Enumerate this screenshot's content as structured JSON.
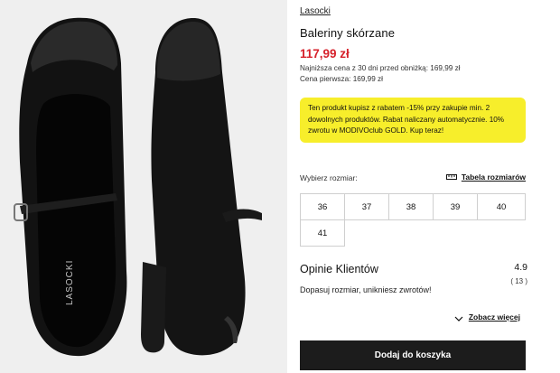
{
  "product": {
    "brand": "Lasocki",
    "title": "Baleriny skórzane",
    "price": "117,99 zł",
    "lowest_price_text": "Najniższa cena z 30 dni przed obniżką: 169,99 zł",
    "first_price_text": "Cena pierwsza: 169,99 zł",
    "image_logo_text": "LASOCKI",
    "price_color": "#d6212b"
  },
  "promo": {
    "text": "Ten produkt kupisz z rabatem -15% przy zakupie min. 2 dowolnych produktów. Rabat naliczany automatycznie. 10% zwrotu w MODIVOclub GOLD. Kup teraz!",
    "background": "#f7ee2b"
  },
  "sizes": {
    "label": "Wybierz rozmiar:",
    "table_link": "Tabela rozmiarów",
    "table_icon": "ruler-icon",
    "options": [
      "36",
      "37",
      "38",
      "39",
      "40",
      "41"
    ]
  },
  "reviews": {
    "title": "Opinie Klientów",
    "rating": "4.9",
    "count": "( 13 )",
    "subtitle": "Dopasuj rozmiar, unikniesz zwrotów!",
    "see_more": "Zobacz więcej",
    "see_more_icon": "chevron-down-icon"
  },
  "cart": {
    "button_label": "Dodaj do koszyka",
    "button_color": "#1c1c1c"
  }
}
